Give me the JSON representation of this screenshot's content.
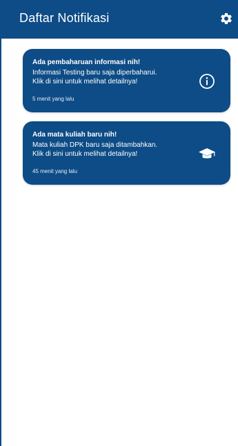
{
  "header": {
    "title": "Daftar Notifikasi",
    "settings_icon": "gear-icon"
  },
  "colors": {
    "primary": "#0d4c86",
    "background": "#ffffff",
    "text_on_primary": "#ffffff"
  },
  "notifications": [
    {
      "title": "Ada pembaharuan informasi nih!",
      "body": "Informasi Testing baru saja diperbaharui.\nKlik di sini untuk melihat detailnya!",
      "time": "5 menit yang lalu",
      "icon": "info-icon"
    },
    {
      "title": "Ada mata kuliah baru nih!",
      "body": "Mata kuliah DPK baru saja ditambahkan.\nKlik di sini untuk melihat detailnya!",
      "time": "45 menit yang lalu",
      "icon": "graduation-cap-icon"
    }
  ]
}
